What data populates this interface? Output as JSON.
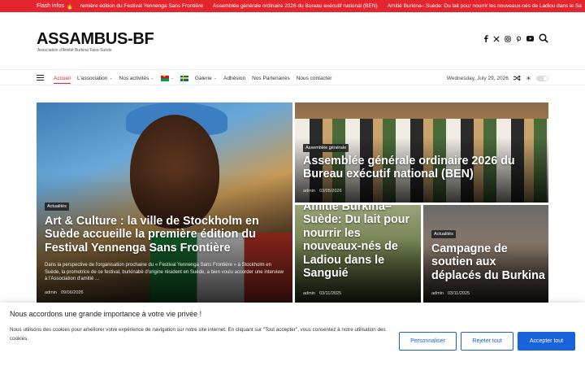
{
  "flash": {
    "label": "Flash infos",
    "icon": "fire-icon",
    "items": [
      "remière édition du Festival Yennenga Sans Frontière",
      "Assemblée générale ordinaire 2026 du Bureau exécutif national (BEN)",
      "Amitié Burkina– Suède: Du lait pour nourrir les nouveaux-nés de Ladiou dans le Sa"
    ]
  },
  "header": {
    "logo": "ASSAMBUS-BF",
    "tagline": "Association d'Amitié Burkina Faso-Suède",
    "socials": [
      "facebook-icon",
      "x-icon",
      "instagram-icon",
      "pinterest-icon",
      "youtube-icon"
    ]
  },
  "nav": {
    "items": [
      {
        "label": "Accueil",
        "active": true
      },
      {
        "label": "L'association",
        "dropdown": true
      },
      {
        "label": "Nos activités",
        "dropdown": true
      },
      {
        "label": "",
        "flag": "burkina-flag-icon",
        "dropdown": true
      },
      {
        "label": "",
        "flag": "sweden-flag-icon"
      },
      {
        "label": "Galerie",
        "dropdown": true
      },
      {
        "label": "Adhésion"
      },
      {
        "label": "Nos Partenaires"
      },
      {
        "label": "Nous contacter"
      }
    ],
    "date": "Wednesday, July 29, 2026"
  },
  "featured": [
    {
      "category": "Actualités",
      "title": "Art & Culture : la ville de Stockholm en Suède accueille la première édition du Festival Yennenga Sans Frontière",
      "excerpt": "Dans la perspective de l'organisation prochaine du « Festival Yennenga Sans Frontière » à Stockholm en Suède, la promotrice de ce festival, burkinabè d'origine résident en Suède, a bien voulu accorder une interview à l'Association d'amitié ...",
      "author": "admin",
      "date": "09/06/2026"
    },
    {
      "category": "Assemblée générale",
      "title": "Assemblée générale ordinaire 2026 du Bureau exécutif national (BEN)",
      "author": "admin",
      "date": "03/05/2026"
    },
    {
      "category": "",
      "title": "Amitié Burkina– Suède: Du lait pour nourrir les nouveaux-nés de Ladiou dans le Sanguié",
      "author": "admin",
      "date": "03/11/2025"
    },
    {
      "category": "Actualités",
      "title": "Campagne de soutien aux déplacés du Burkina",
      "author": "admin",
      "date": "03/11/2025"
    }
  ],
  "cookie": {
    "title": "Nous accordons une grande importance à votre vie privée !",
    "text": "Nous utilisons des cookies pour améliorer votre expérience de navigation sur notre site internet. En cliquant sur \"Tout accepter\", vous consentez à notre utilisation des cookies.",
    "customize": "Personnaliser",
    "reject": "Rejeter tout",
    "accept": "Accepter tout"
  },
  "colors": {
    "accent": "#e5252e",
    "button": "#1863dc"
  }
}
